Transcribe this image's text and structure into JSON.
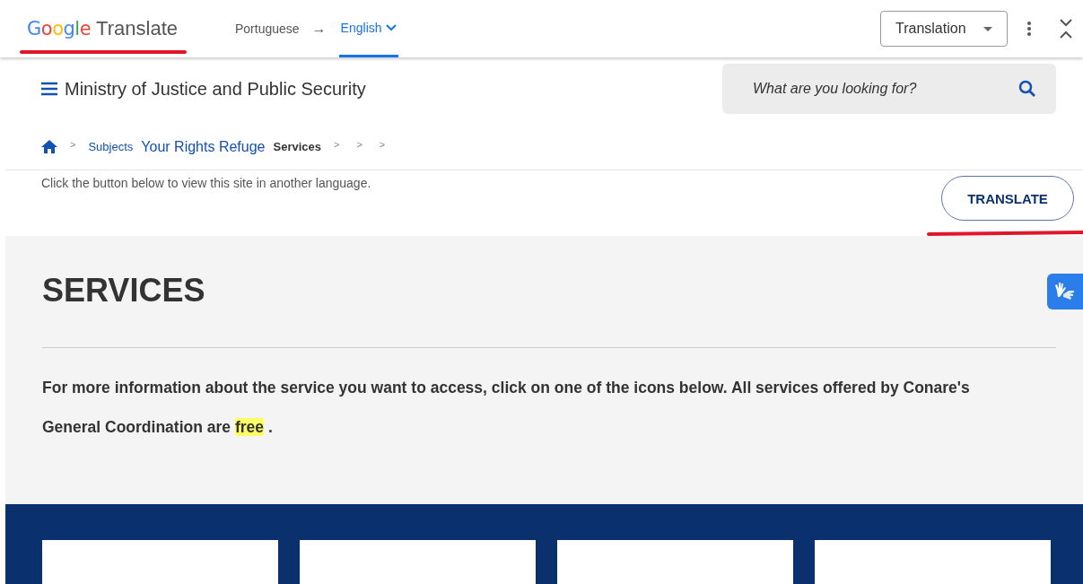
{
  "translate_bar": {
    "logo_brand": "Google",
    "logo_product": "Translate",
    "source_language": "Portuguese",
    "arrow": "→",
    "target_tabs": [
      {
        "label": "English",
        "selected": true
      }
    ],
    "mode_dropdown": "Translation"
  },
  "site_header": {
    "title": "Ministry of Justice and Public Security",
    "search": {
      "placeholder": "What are you looking for?"
    }
  },
  "breadcrumb": {
    "items": [
      {
        "label": "Subjects",
        "kind": "link"
      },
      {
        "label": "Your Rights Refuge",
        "kind": "large-link"
      },
      {
        "label": "Services",
        "kind": "current"
      }
    ],
    "separators": [
      ">",
      ">",
      ">",
      ">"
    ]
  },
  "language_notice": {
    "text": "Click the button below to view this site in another language.",
    "button": "TRANSLATE"
  },
  "services": {
    "heading": "SERVICES",
    "intro_before": "For more information about the service you want to access, click on one of the icons below. All services offered by Conare's General Coordination are ",
    "intro_highlight": "free",
    "intro_after": " ."
  },
  "service_cards": [
    {
      "kind": "picture-less"
    },
    {
      "kind": "picture-less"
    },
    {
      "kind": "picture-less"
    },
    {
      "kind": "picture-less"
    }
  ]
}
